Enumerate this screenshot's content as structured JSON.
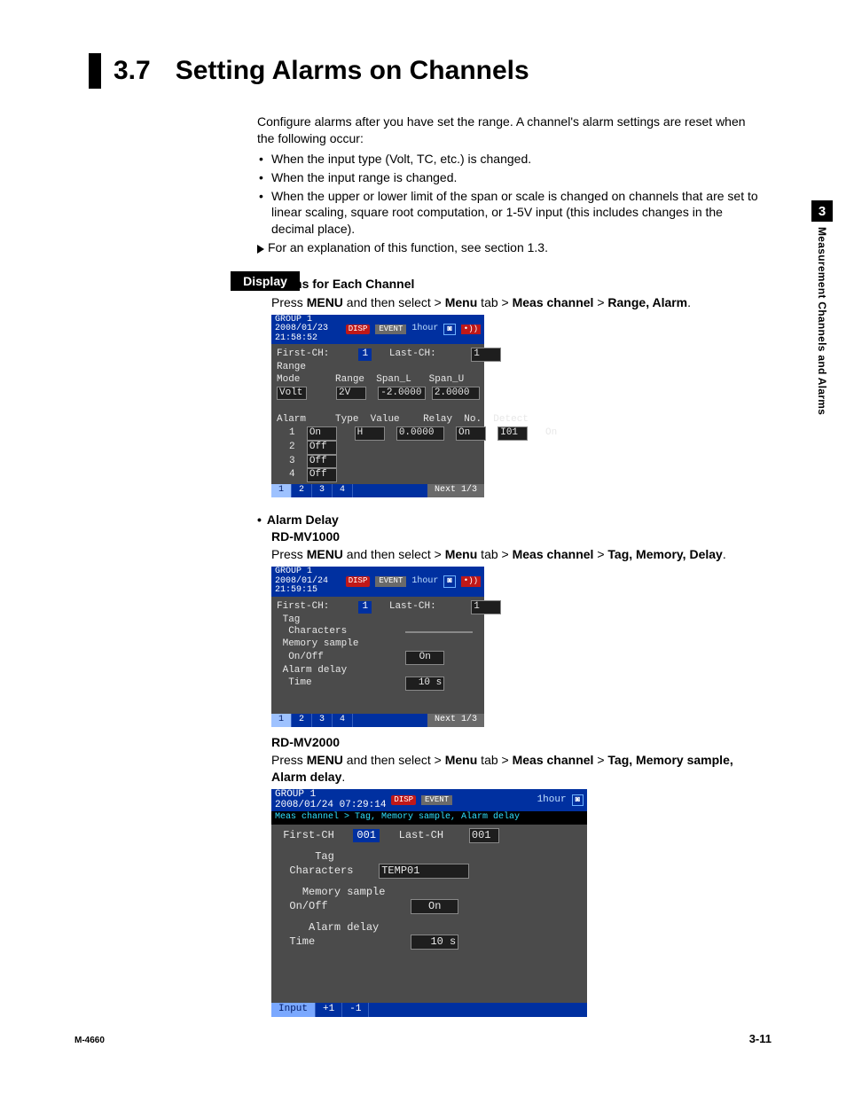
{
  "header": {
    "section_number": "3.7",
    "section_title": "Setting Alarms on Channels"
  },
  "intro": {
    "lead": "Configure alarms after you have set the range. A channel's alarm settings are reset when the following occur:",
    "bullets": [
      "When the input type (Volt, TC, etc.) is changed.",
      "When the input range is changed.",
      "When the upper or lower limit of the span or scale is changed on channels that are set to linear scaling, square root computation, or 1-5V input (this includes changes in the decimal place)."
    ],
    "note": "For an explanation of this function, see section 1.3."
  },
  "display_label": "Display",
  "alarms_each": {
    "heading": "Alarms for Each Channel",
    "instr_pre": "Press ",
    "instr_b1": "MENU",
    "instr_mid": " and then select > ",
    "instr_b2": "Menu",
    "instr_tab": " tab > ",
    "instr_b3": "Meas channel",
    "instr_gt": " > ",
    "instr_b4": "Range, Alarm",
    "instr_end": "."
  },
  "scr1": {
    "group": "GROUP 1",
    "ts": "2008/01/23 21:58:52",
    "event": "EVENT",
    "hour": "1hour",
    "first_ch_lbl": "First-CH:",
    "first_ch_val": "1",
    "last_ch_lbl": "Last-CH:",
    "last_ch_val": "1",
    "range_lbl": "Range",
    "mode_lbl": "Mode",
    "range_col": "Range",
    "span_l": "Span_L",
    "span_u": "Span_U",
    "mode_val": "Volt",
    "range_val": "2V",
    "span_l_val": "-2.0000",
    "span_u_val": "2.0000",
    "alarm_lbl": "Alarm",
    "hdr_type": "Type",
    "hdr_value": "Value",
    "hdr_relay": "Relay",
    "hdr_no": "No.",
    "hdr_detect": "Detect",
    "rows": [
      {
        "n": "1",
        "on": "On",
        "type": "H",
        "value": "0.0000",
        "relay": "On",
        "no": "I01",
        "detect": "On"
      },
      {
        "n": "2",
        "on": "Off"
      },
      {
        "n": "3",
        "on": "Off"
      },
      {
        "n": "4",
        "on": "Off"
      }
    ],
    "footer": [
      "1",
      "2",
      "3",
      "4"
    ],
    "next": "Next 1/3"
  },
  "alarm_delay": {
    "heading": "Alarm Delay",
    "model1": "RD-MV1000",
    "instr1_b4": "Tag, Memory, Delay",
    "model2": "RD-MV2000",
    "instr2_b4": "Tag, Memory sample, Alarm delay"
  },
  "scr2": {
    "group": "GROUP 1",
    "ts": "2008/01/24 21:59:15",
    "event": "EVENT",
    "hour": "1hour",
    "first_ch_lbl": "First-CH:",
    "first_ch_val": "1",
    "last_ch_lbl": "Last-CH:",
    "last_ch_val": "1",
    "tag_lbl": "Tag",
    "chars_lbl": "Characters",
    "chars_val": "",
    "mem_lbl": "Memory sample",
    "onoff_lbl": "On/Off",
    "onoff_val": "On",
    "ad_lbl": "Alarm delay",
    "time_lbl": "Time",
    "time_val": "10 s",
    "footer": [
      "1",
      "2",
      "3",
      "4"
    ],
    "next": "Next 1/3"
  },
  "scr3": {
    "group": "GROUP 1",
    "ts": "2008/01/24 07:29:14",
    "event": "EVENT",
    "hour": "1hour",
    "breadcrumb": "Meas channel > Tag, Memory sample, Alarm delay",
    "first_ch_lbl": "First-CH",
    "first_ch_val": "001",
    "last_ch_lbl": "Last-CH",
    "last_ch_val": "001",
    "tag_lbl": "Tag",
    "chars_lbl": "Characters",
    "chars_val": "TEMP01",
    "mem_lbl": "Memory sample",
    "onoff_lbl": "On/Off",
    "onoff_val": "On",
    "ad_lbl": "Alarm delay",
    "time_lbl": "Time",
    "time_val": "10 s",
    "footer_input": "Input",
    "footer_plus": "+1",
    "footer_minus": "-1"
  },
  "side": {
    "chapter": "3",
    "label": "Measurement Channels and Alarms"
  },
  "footer": {
    "left": "M-4660",
    "right": "3-11"
  }
}
